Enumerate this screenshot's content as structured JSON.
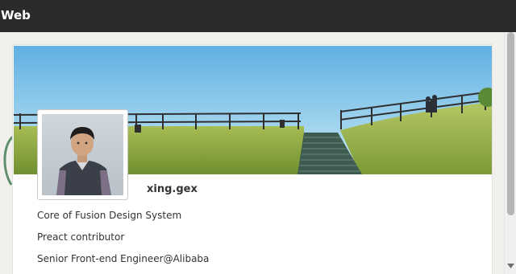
{
  "window": {
    "title": "Web"
  },
  "profile": {
    "username": "xing.gex",
    "bio": [
      "Core of Fusion Design System",
      "Preact contributor",
      "Senior Front-end Engineer@Alibaba"
    ]
  },
  "colors": {
    "titlebar": "#2b2b2b",
    "sky": "#6fb6e0",
    "grass": "#8faa3c",
    "accent_curve": "#5f8f6a"
  },
  "icons": {
    "scroll_down": "triangle-down"
  }
}
